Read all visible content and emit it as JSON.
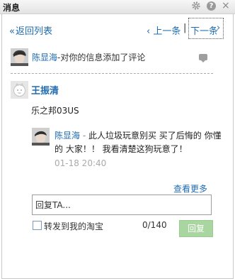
{
  "window": {
    "title": "消息",
    "close_glyph": "×",
    "help_glyph": "?"
  },
  "nav": {
    "back_arrow": "«",
    "back_label": "返回列表",
    "prev_arrow": "‹",
    "prev_label": "上一条",
    "separator": "|",
    "next_label": "下一条",
    "next_arrow": "›"
  },
  "notification": {
    "user": "陈显海",
    "action": "-对你的信息添加了评论"
  },
  "post": {
    "author": "王振清",
    "text": "乐之邦03US"
  },
  "reply": {
    "user": "陈显海",
    "dash": " - ",
    "text": "此人垃圾玩意别买 买了后悔的 你懂的 大家！！ 我看清楚这狗玩意了！",
    "time": "01-18 20:40"
  },
  "more_label": "查看更多",
  "composer": {
    "value": "回复TA...",
    "forward_label": "转发到我的淘宝",
    "count": "0/140",
    "submit_label": "回复"
  }
}
